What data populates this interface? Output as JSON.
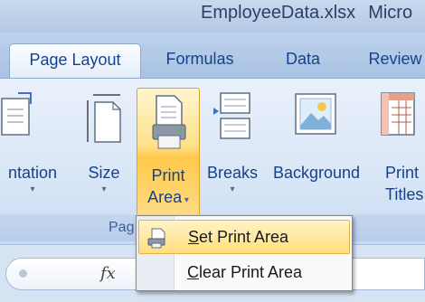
{
  "window": {
    "title": "EmployeeData.xlsx",
    "title_suffix": "Micro"
  },
  "tabs": [
    {
      "label": "Page Layout",
      "active": true
    },
    {
      "label": "Formulas",
      "active": false
    },
    {
      "label": "Data",
      "active": false
    },
    {
      "label": "Review",
      "active": false
    }
  ],
  "ribbon": {
    "buttons": {
      "orientation": {
        "label": "ntation",
        "has_caret": true
      },
      "size": {
        "label": "Size",
        "has_caret": true
      },
      "print_area": {
        "label_line1": "Print",
        "label_line2": "Area",
        "has_caret": true
      },
      "breaks": {
        "label": "Breaks",
        "has_caret": true
      },
      "background": {
        "label": "Background"
      },
      "print_titles": {
        "label_line1": "Print",
        "label_line2": "Titles"
      }
    },
    "group_label": "Pag"
  },
  "formula_bar": {
    "fx_label": "fx",
    "value": ""
  },
  "dropdown": {
    "items": [
      {
        "mnemonic": "S",
        "rest": "et Print Area",
        "highlighted": true
      },
      {
        "mnemonic": "C",
        "rest": "lear Print Area",
        "highlighted": false
      }
    ]
  },
  "colors": {
    "accent_highlight": "#ffd86a",
    "ribbon_text": "#15428b",
    "ribbon_bg": "#dbe6f4"
  }
}
